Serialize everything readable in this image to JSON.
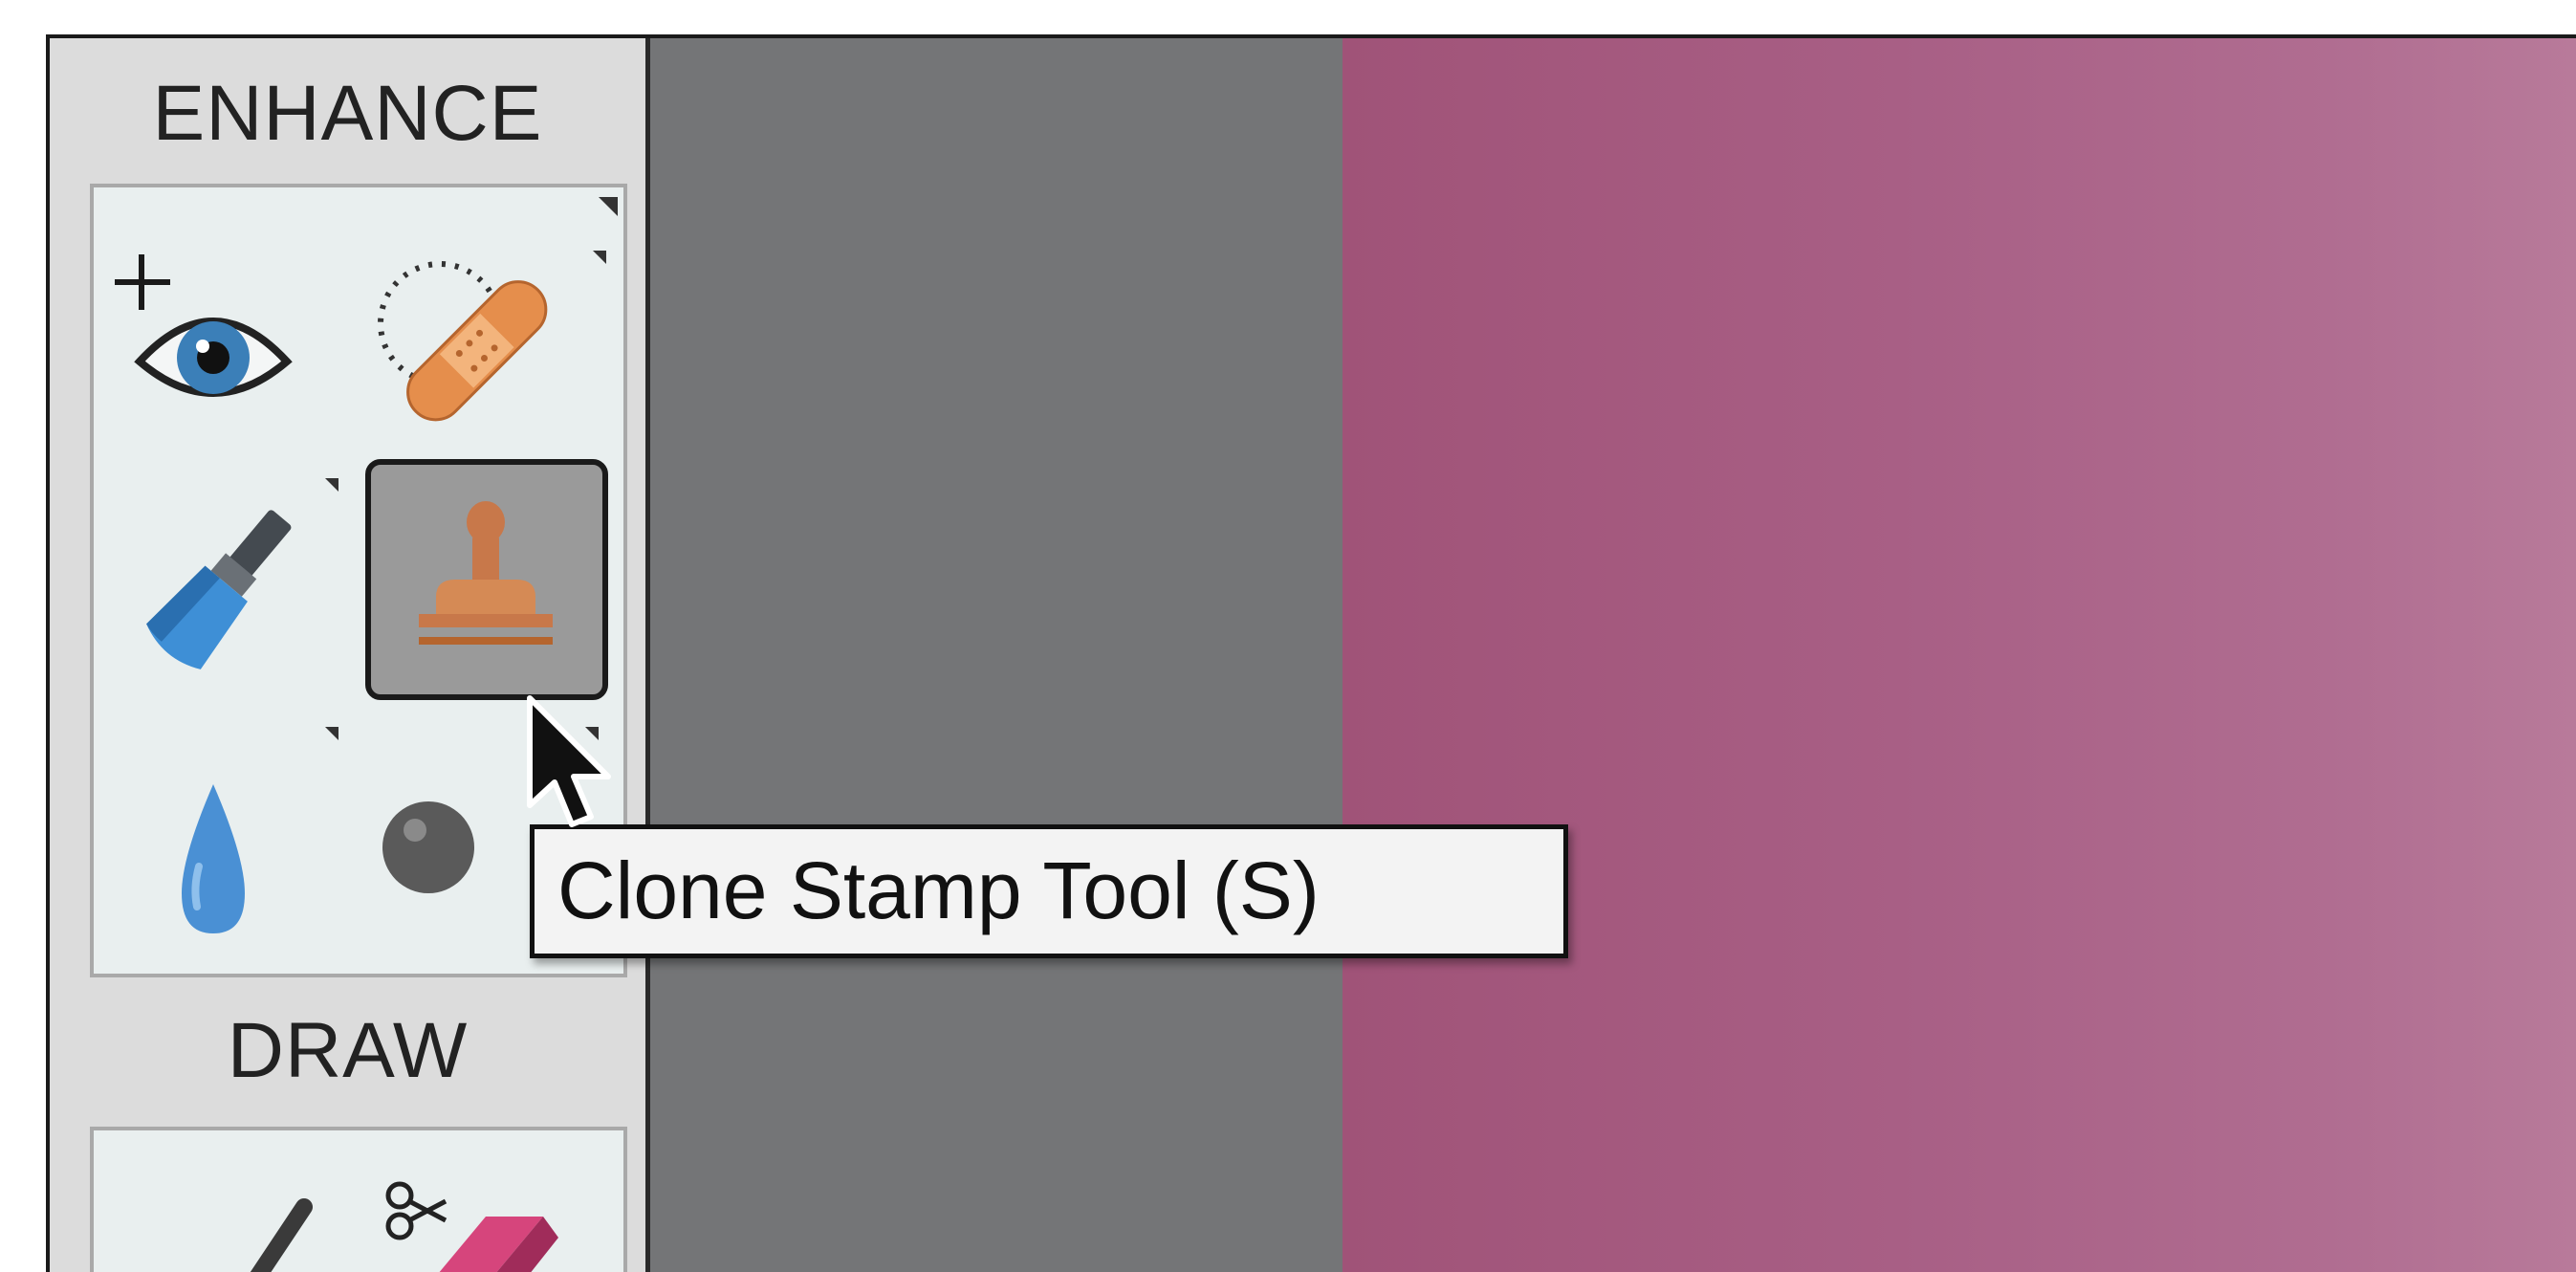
{
  "panel": {
    "enhance_title": "ENHANCE",
    "draw_title": "DRAW",
    "enhance_tools": [
      {
        "name": "red-eye-removal-tool",
        "icon": "eye-plus-icon"
      },
      {
        "name": "spot-healing-brush-tool",
        "icon": "bandage-icon"
      },
      {
        "name": "smart-brush-tool",
        "icon": "paint-brush-icon"
      },
      {
        "name": "clone-stamp-tool",
        "icon": "stamp-icon",
        "selected": true
      },
      {
        "name": "blur-tool",
        "icon": "water-drop-icon"
      },
      {
        "name": "sponge-tool",
        "icon": "sponge-icon"
      }
    ],
    "draw_tools": [
      {
        "name": "brush-tool",
        "icon": "pencil-icon"
      },
      {
        "name": "eraser-tool",
        "icon": "scissors-eraser-icon"
      }
    ]
  },
  "tooltip": {
    "text": "Clone Stamp Tool (S)"
  },
  "colors": {
    "panel_bg": "#dcdcdc",
    "canvas_gray": "#747577",
    "canvas_pink": "#a85f85",
    "stamp_orange": "#c8784a",
    "eye_blue": "#3b7fb8"
  }
}
